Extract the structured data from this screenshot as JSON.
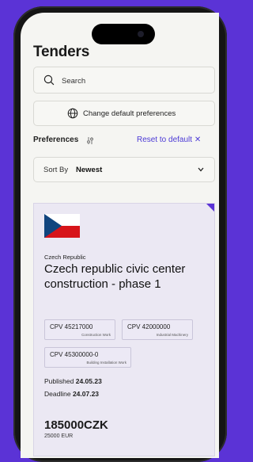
{
  "header": {
    "title": "Tenders"
  },
  "search": {
    "placeholder": "Search"
  },
  "preferences": {
    "change_label": "Change default preferences",
    "title": "Preferences",
    "reset_label": "Reset to default ✕"
  },
  "sort": {
    "label": "Sort By",
    "value": "Newest"
  },
  "tender": {
    "country": "Czech Republic",
    "title": "Czech republic civic center construction - phase 1",
    "cpv": [
      {
        "code": "CPV 45217000",
        "desc": "Construction Work"
      },
      {
        "code": "CPV 42000000",
        "desc": "Industrial Machinery"
      },
      {
        "code": "CPV 45300000-0",
        "desc": "Building Installation Work"
      }
    ],
    "published_label": "Published",
    "published_date": "24.05.23",
    "deadline_label": "Deadline",
    "deadline_date": "24.07.23",
    "price": "185000CZK",
    "price_eur": "25000 EUR"
  },
  "colors": {
    "accent": "#5b33d6",
    "link": "#4c3ad6",
    "background": "#f5f5f2"
  },
  "icons": [
    "search-icon",
    "globe-icon",
    "sliders-icon",
    "chevron-down-icon",
    "czech-flag-icon"
  ]
}
